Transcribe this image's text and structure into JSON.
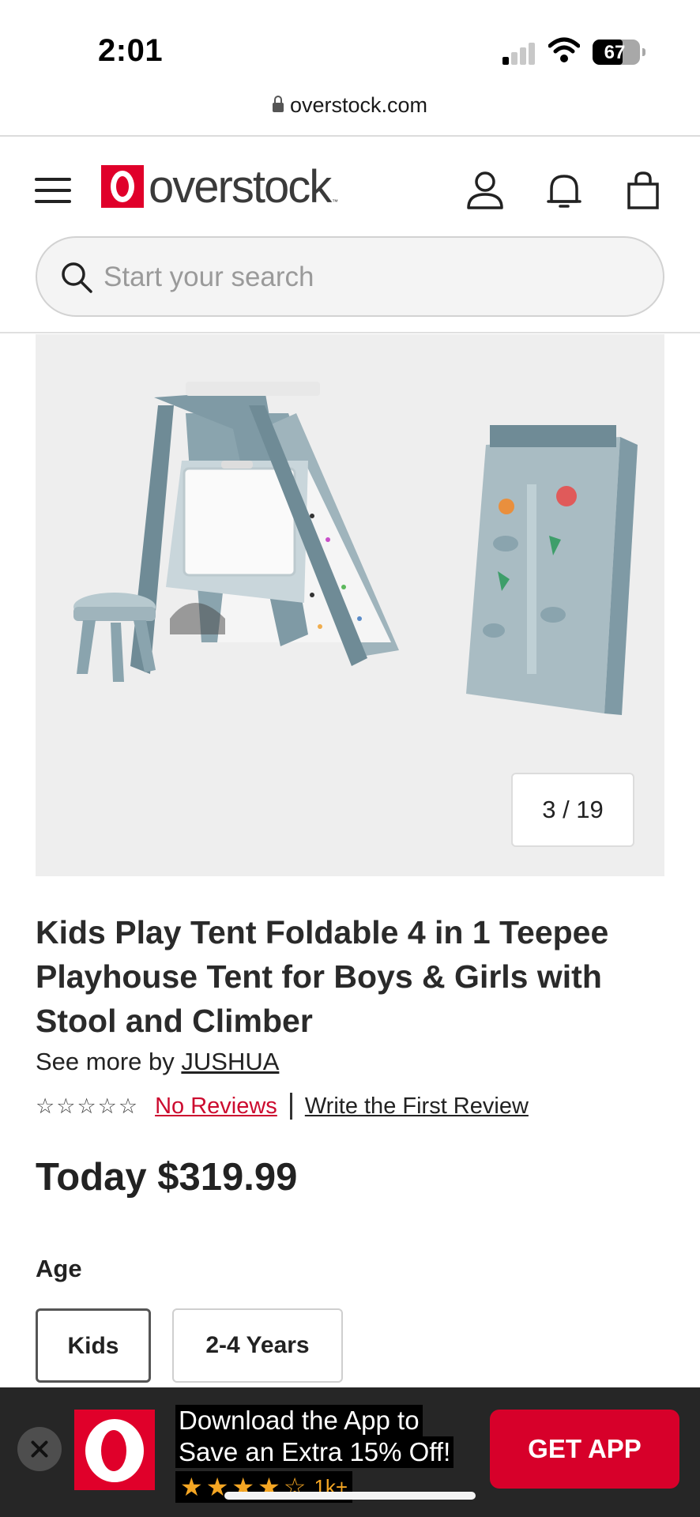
{
  "status_bar": {
    "time": "2:01",
    "battery": "67"
  },
  "browser": {
    "url": "overstock.com"
  },
  "header": {
    "logo_text": "overstock",
    "logo_tm": "™",
    "search_placeholder": "Start your search"
  },
  "gallery": {
    "counter": "3 / 19"
  },
  "product": {
    "title": "Kids Play Tent Foldable 4 in 1 Teepee Playhouse Tent for Boys & Girls with Stool and Climber",
    "see_more_prefix": "See more by ",
    "brand": "JUSHUA",
    "rating_stars": 0,
    "no_reviews": "No Reviews",
    "write_review": "Write the First Review",
    "price": "Today $319.99"
  },
  "options": {
    "label": "Age",
    "items": [
      "Kids",
      "2-4 Years"
    ],
    "selected": "Kids"
  },
  "app_banner": {
    "line1": "Download the App to",
    "line2": "Save an Extra 15% Off!",
    "rating_count": "1k+",
    "button": "GET APP"
  },
  "colors": {
    "brand_red": "#e0002a",
    "link_red": "#cc0b2f",
    "banner_bg": "#262626",
    "star_gold": "#f5a623"
  }
}
